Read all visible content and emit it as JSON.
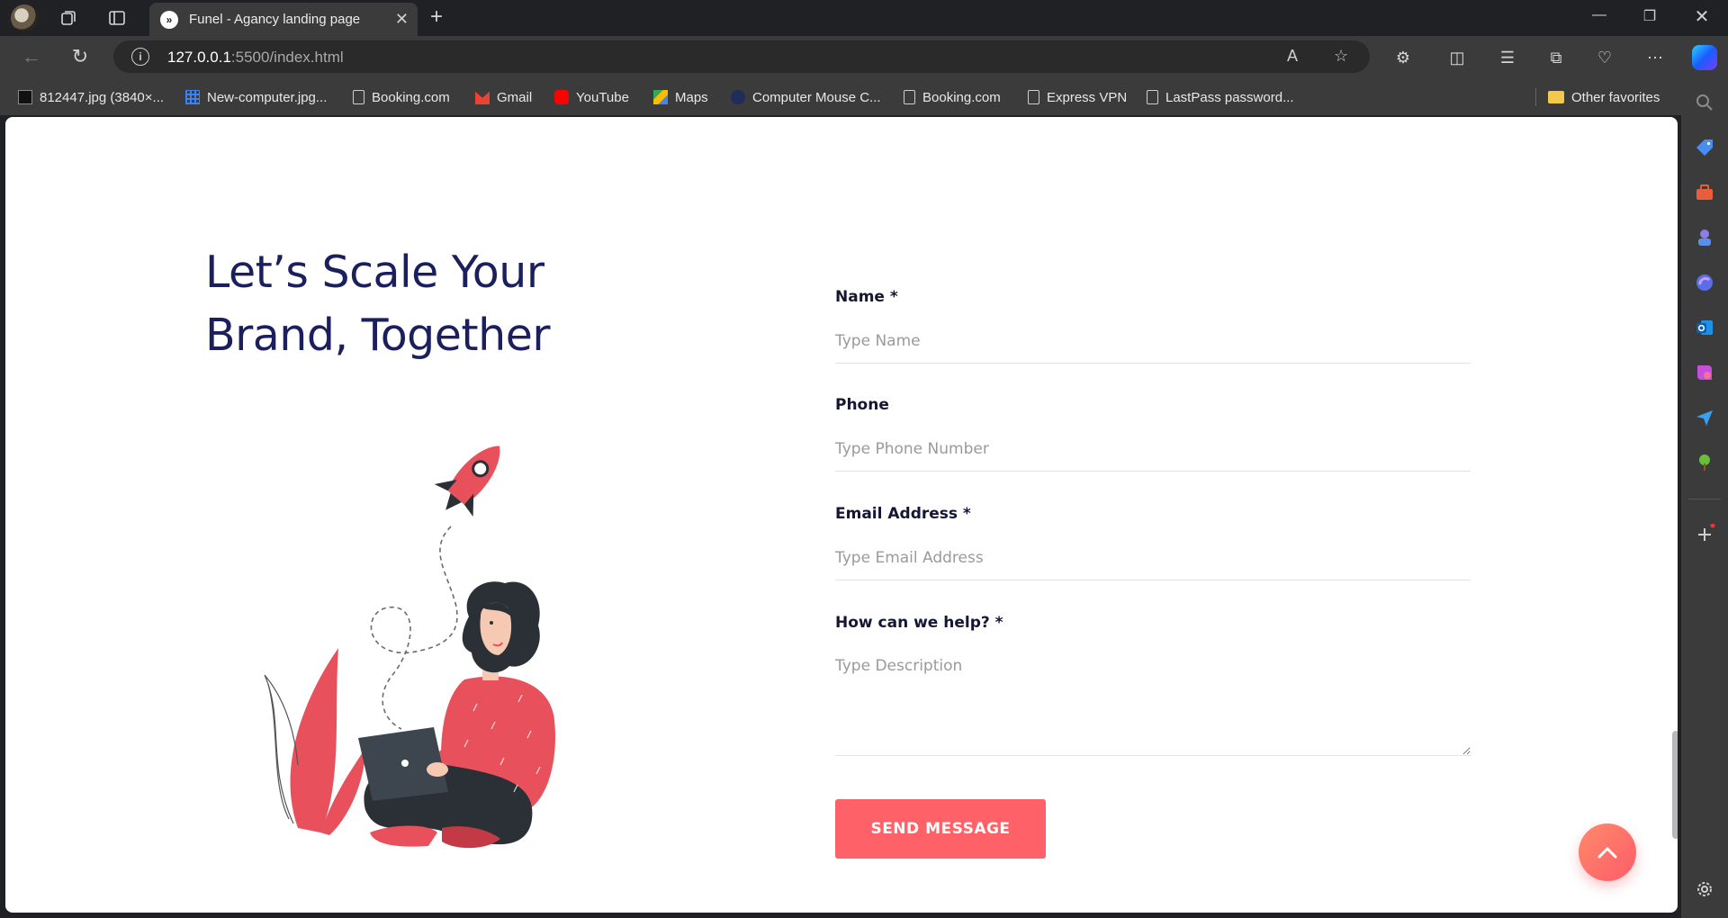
{
  "browser": {
    "tab_title": "Funel - Agancy landing page",
    "url_host": "127.0.0.1",
    "url_path": ":5500/index.html",
    "bookmarks": [
      {
        "label": "812447.jpg (3840×...",
        "icon": "image-icon"
      },
      {
        "label": "New-computer.jpg...",
        "icon": "grid-icon"
      },
      {
        "label": "Booking.com",
        "icon": "file-icon"
      },
      {
        "label": "Gmail",
        "icon": "gmail-icon"
      },
      {
        "label": "YouTube",
        "icon": "youtube-icon"
      },
      {
        "label": "Maps",
        "icon": "maps-icon"
      },
      {
        "label": "Computer Mouse C...",
        "icon": "mouse-icon"
      },
      {
        "label": "Booking.com",
        "icon": "file-icon"
      },
      {
        "label": "Express VPN",
        "icon": "file-icon"
      },
      {
        "label": "LastPass password...",
        "icon": "file-icon"
      }
    ],
    "other_favorites": "Other favorites"
  },
  "page": {
    "heading": "Let’s Scale Your Brand, Together",
    "form": {
      "name_label": "Name *",
      "name_placeholder": "Type Name",
      "phone_label": "Phone",
      "phone_placeholder": "Type Phone Number",
      "email_label": "Email Address *",
      "email_placeholder": "Type Email Address",
      "help_label": "How can we help? *",
      "help_placeholder": "Type Description",
      "submit_label": "SEND MESSAGE"
    }
  },
  "colors": {
    "heading": "#1c1f5e",
    "accent": "#fe6167",
    "label": "#141633"
  }
}
